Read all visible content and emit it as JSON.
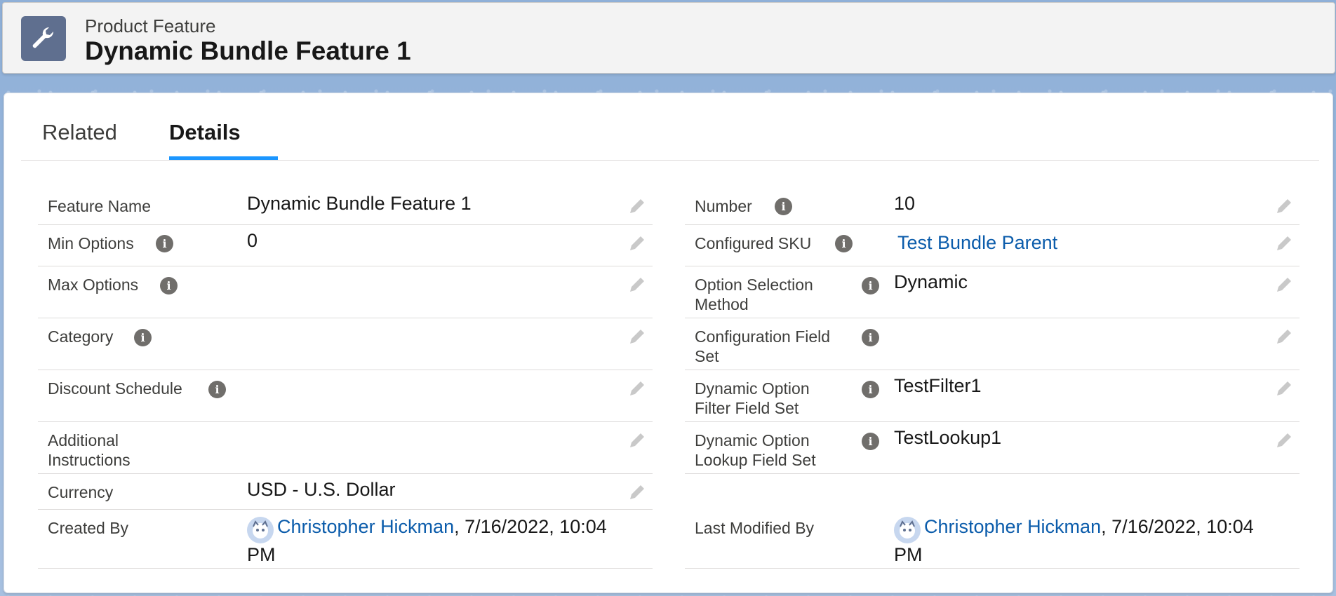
{
  "header": {
    "icon": "wrench-icon",
    "object_label": "Product Feature",
    "record_title": "Dynamic Bundle Feature 1"
  },
  "tabs": [
    {
      "label": "Related",
      "active": false
    },
    {
      "label": "Details",
      "active": true
    }
  ],
  "left_fields": [
    {
      "label": "Feature Name",
      "value": "Dynamic Bundle Feature 1",
      "info": false
    },
    {
      "label": "Min Options",
      "value": "0",
      "info": true
    },
    {
      "label": "Max Options",
      "value": "",
      "info": true
    },
    {
      "label": "Category",
      "value": "",
      "info": true
    },
    {
      "label": "Discount Schedule",
      "value": "",
      "info": true
    },
    {
      "label": "Additional Instructions",
      "value": "",
      "info": false
    },
    {
      "label": "Currency",
      "value": "USD - U.S. Dollar",
      "info": false
    }
  ],
  "right_fields": [
    {
      "label": "Number",
      "value": "10",
      "info": true
    },
    {
      "label": "Configured SKU",
      "value": "Test Bundle Parent",
      "info": true,
      "link": true
    },
    {
      "label": "Option Selection Method",
      "value": "Dynamic",
      "info": true
    },
    {
      "label": "Configuration Field Set",
      "value": "",
      "info": true
    },
    {
      "label": "Dynamic Option Filter Field Set",
      "value": "TestFilter1",
      "info": true
    },
    {
      "label": "Dynamic Option Lookup Field Set",
      "value": "TestLookup1",
      "info": true
    }
  ],
  "created": {
    "label": "Created By",
    "user": "Christopher Hickman",
    "datetime": ", 7/16/2022, 10:04",
    "datetime_cont": "PM"
  },
  "modified": {
    "label": "Last Modified By",
    "user": "Christopher Hickman",
    "datetime": ", 7/16/2022, 10:04",
    "datetime_cont": "PM"
  },
  "colors": {
    "link": "#0b5cab",
    "tab_active_underline": "#1b96ff",
    "header_icon_bg": "#5f6f8f"
  }
}
